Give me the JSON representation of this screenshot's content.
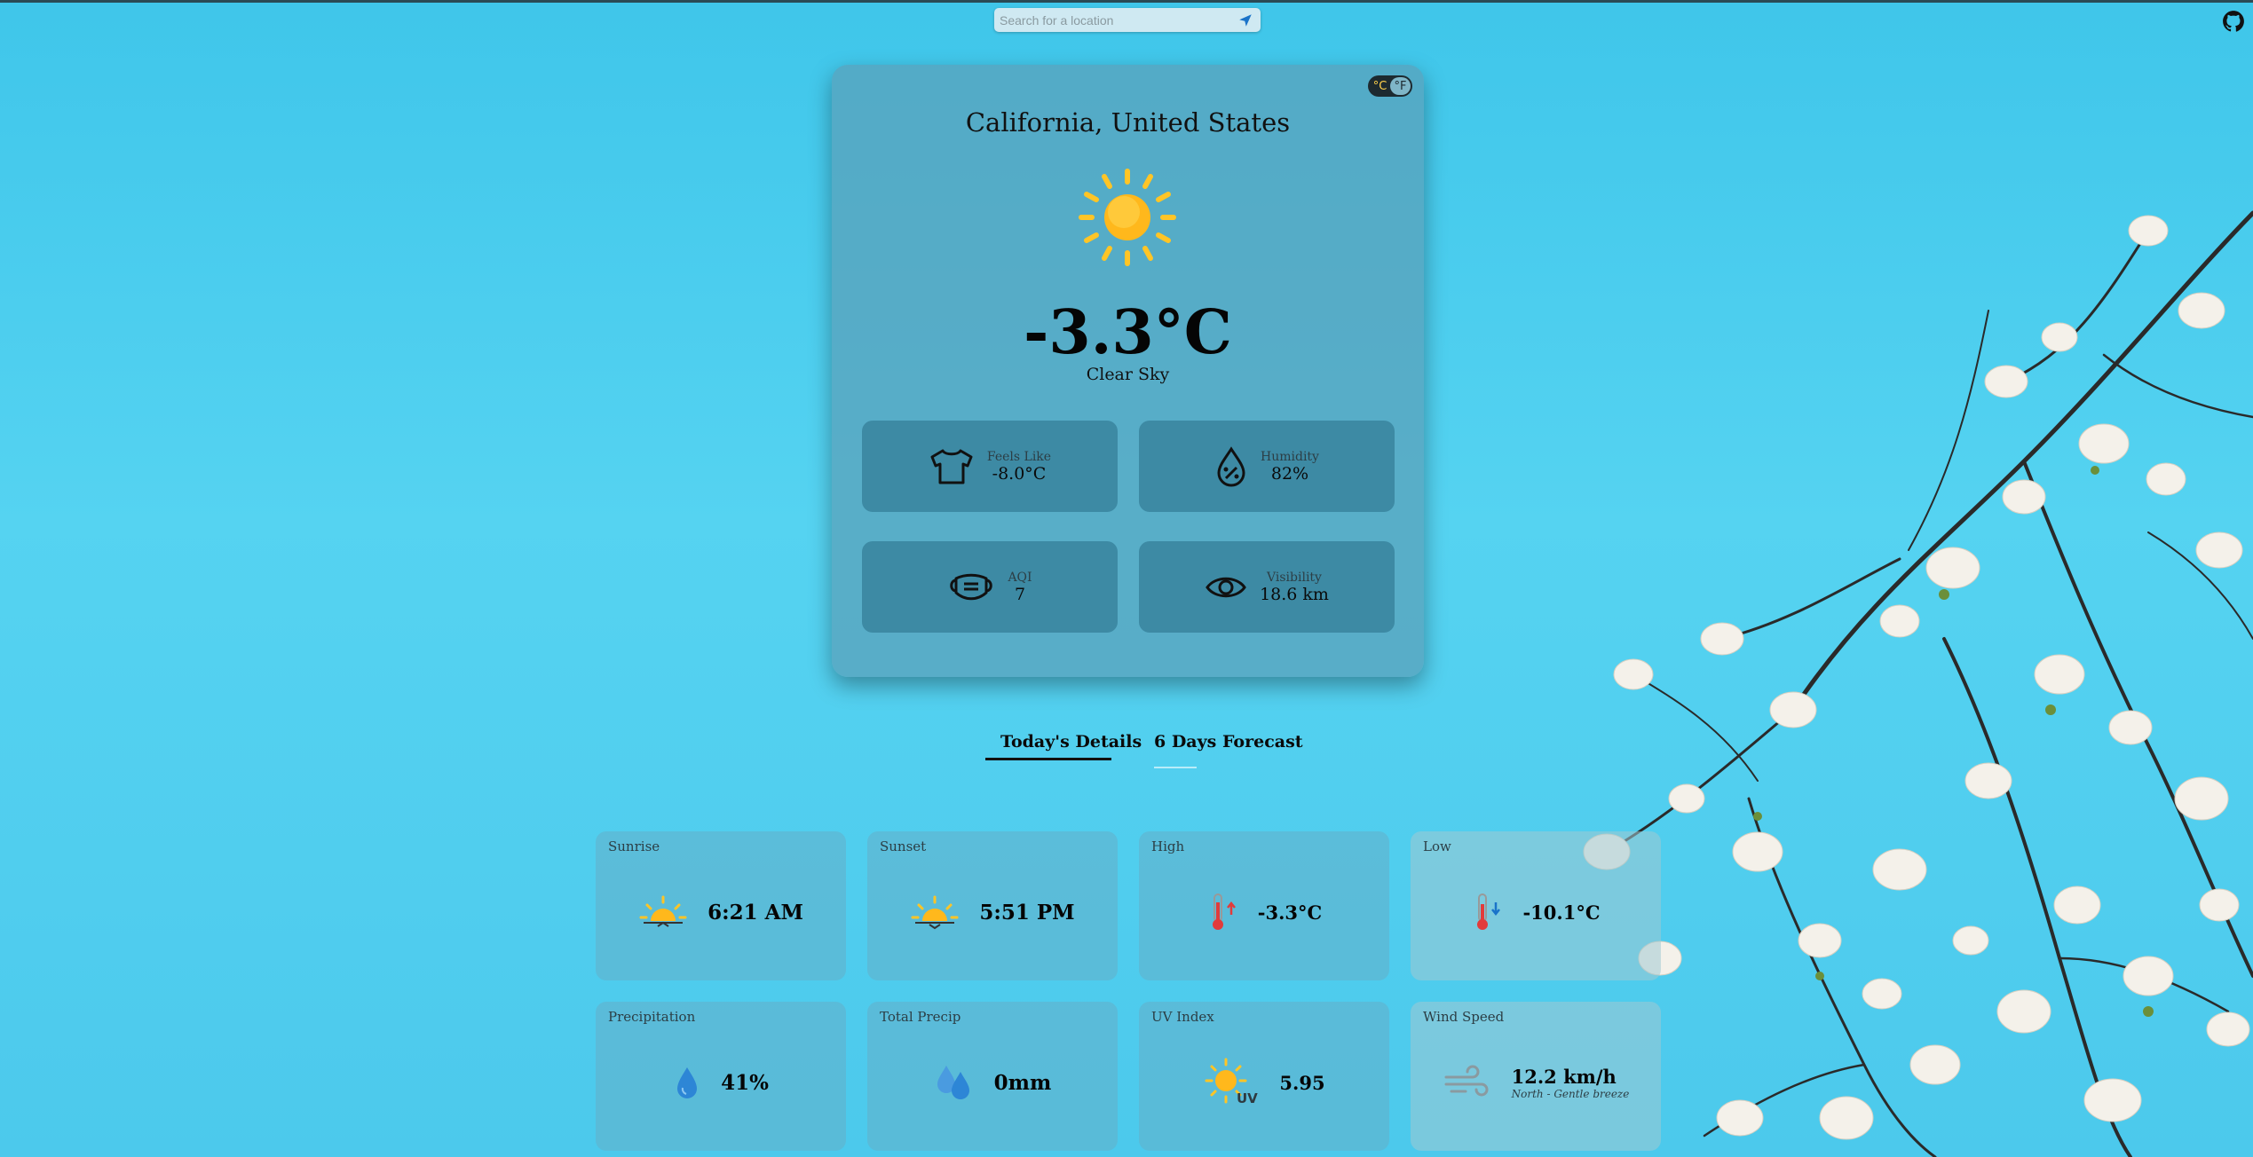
{
  "search": {
    "placeholder": "Search for a location"
  },
  "weather": {
    "location": "California, United States",
    "temperature": "-3.3°C",
    "condition": "Clear Sky",
    "units": {
      "celsius": "°C",
      "fahrenheit": "°F"
    }
  },
  "tiles": [
    {
      "label": "Feels Like",
      "value": "-8.0°C",
      "icon": "shirt-icon"
    },
    {
      "label": "Humidity",
      "value": "82%",
      "icon": "humidity-drop-icon"
    },
    {
      "label": "AQI",
      "value": "7",
      "icon": "mask-icon"
    },
    {
      "label": "Visibility",
      "value": "18.6 km",
      "icon": "eye-icon"
    }
  ],
  "tabs": {
    "today": "Today's Details",
    "forecast": "6 Days Forecast"
  },
  "details": [
    {
      "title": "Sunrise",
      "value": "6:21 AM",
      "icon": "sunrise-icon"
    },
    {
      "title": "Sunset",
      "value": "5:51 PM",
      "icon": "sunset-icon"
    },
    {
      "title": "High",
      "value": "-3.3°C",
      "icon": "thermometer-up-icon"
    },
    {
      "title": "Low",
      "value": "-10.1°C",
      "icon": "thermometer-down-icon"
    },
    {
      "title": "Precipitation",
      "value": "41%",
      "icon": "raindrop-icon"
    },
    {
      "title": "Total Precip",
      "value": "0mm",
      "icon": "raindrops-icon"
    },
    {
      "title": "UV Index",
      "value": "5.95",
      "icon": "uv-sun-icon"
    },
    {
      "title": "Wind Speed",
      "value": "12.2 km/h",
      "sub": "North - Gentle breeze",
      "icon": "wind-icon"
    }
  ],
  "colors": {
    "sun": "#ffc526",
    "accent": "#1a73c9",
    "background": "#4cc9ec"
  }
}
